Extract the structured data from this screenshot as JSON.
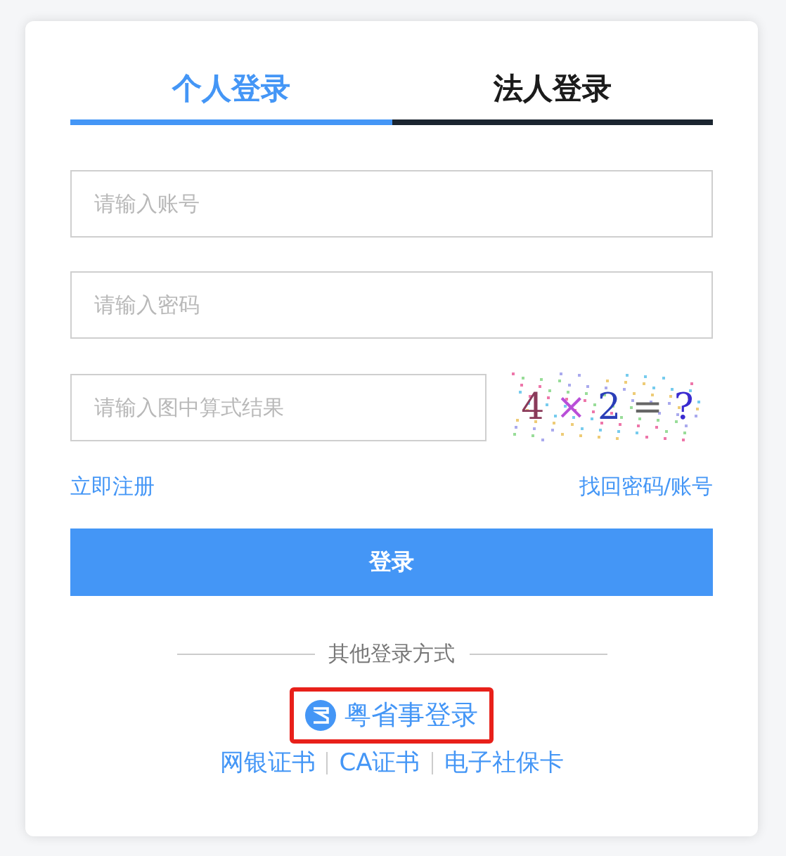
{
  "tabs": [
    {
      "label": "个人登录",
      "selected": true
    },
    {
      "label": "法人登录",
      "selected": false
    }
  ],
  "fields": [
    {
      "placeholder": "请输入账号"
    },
    {
      "placeholder": "请输入密码"
    }
  ],
  "captcha_field": {
    "placeholder": "请输入图中算式结果"
  },
  "captcha": [
    "4",
    "×",
    "2",
    "=",
    "?"
  ],
  "links": {
    "register": "立即注册",
    "recover": "找回密码/账号"
  },
  "login_button": "登录",
  "other_title": "其他登录方式",
  "app_login": {
    "label": "粤省事登录",
    "highlighted": true
  },
  "other_methods": [
    "网银证书",
    "CA证书",
    "电子社保卡"
  ]
}
